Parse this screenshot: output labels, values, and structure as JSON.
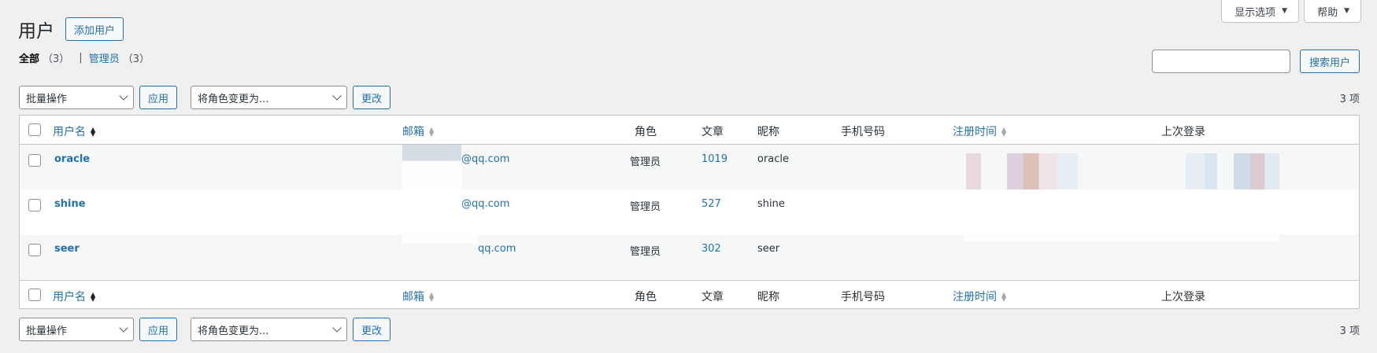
{
  "screen_meta": {
    "display_options": "显示选项",
    "help": "帮助"
  },
  "header": {
    "title": "用户",
    "add_button": "添加用户"
  },
  "filters": {
    "all_label": "全部",
    "all_count": "（3）",
    "separator": "|",
    "admin_label": "管理员",
    "admin_count": "（3）"
  },
  "search": {
    "button": "搜索用户",
    "placeholder": ""
  },
  "tablenav": {
    "bulk_select": "批量操作",
    "apply": "应用",
    "role_select": "将角色变更为...",
    "change": "更改",
    "items_count": "3 项"
  },
  "columns": {
    "username": "用户名",
    "email": "邮箱",
    "role": "角色",
    "posts": "文章",
    "nickname": "昵称",
    "phone": "手机号码",
    "registered": "注册时间",
    "last_login": "上次登录"
  },
  "rows": [
    {
      "username": "oracle",
      "email": "@qq.com",
      "role": "管理员",
      "posts": "1019",
      "nickname": "oracle"
    },
    {
      "username": "shine",
      "email": "@qq.com",
      "role": "管理员",
      "posts": "527",
      "nickname": "shine"
    },
    {
      "username": "seer",
      "email": "qq.com",
      "role": "管理员",
      "posts": "302",
      "nickname": "seer"
    }
  ],
  "colors": {
    "accent": "#2271b1",
    "background": "#f0f0f1",
    "border": "#c3c4c7"
  }
}
